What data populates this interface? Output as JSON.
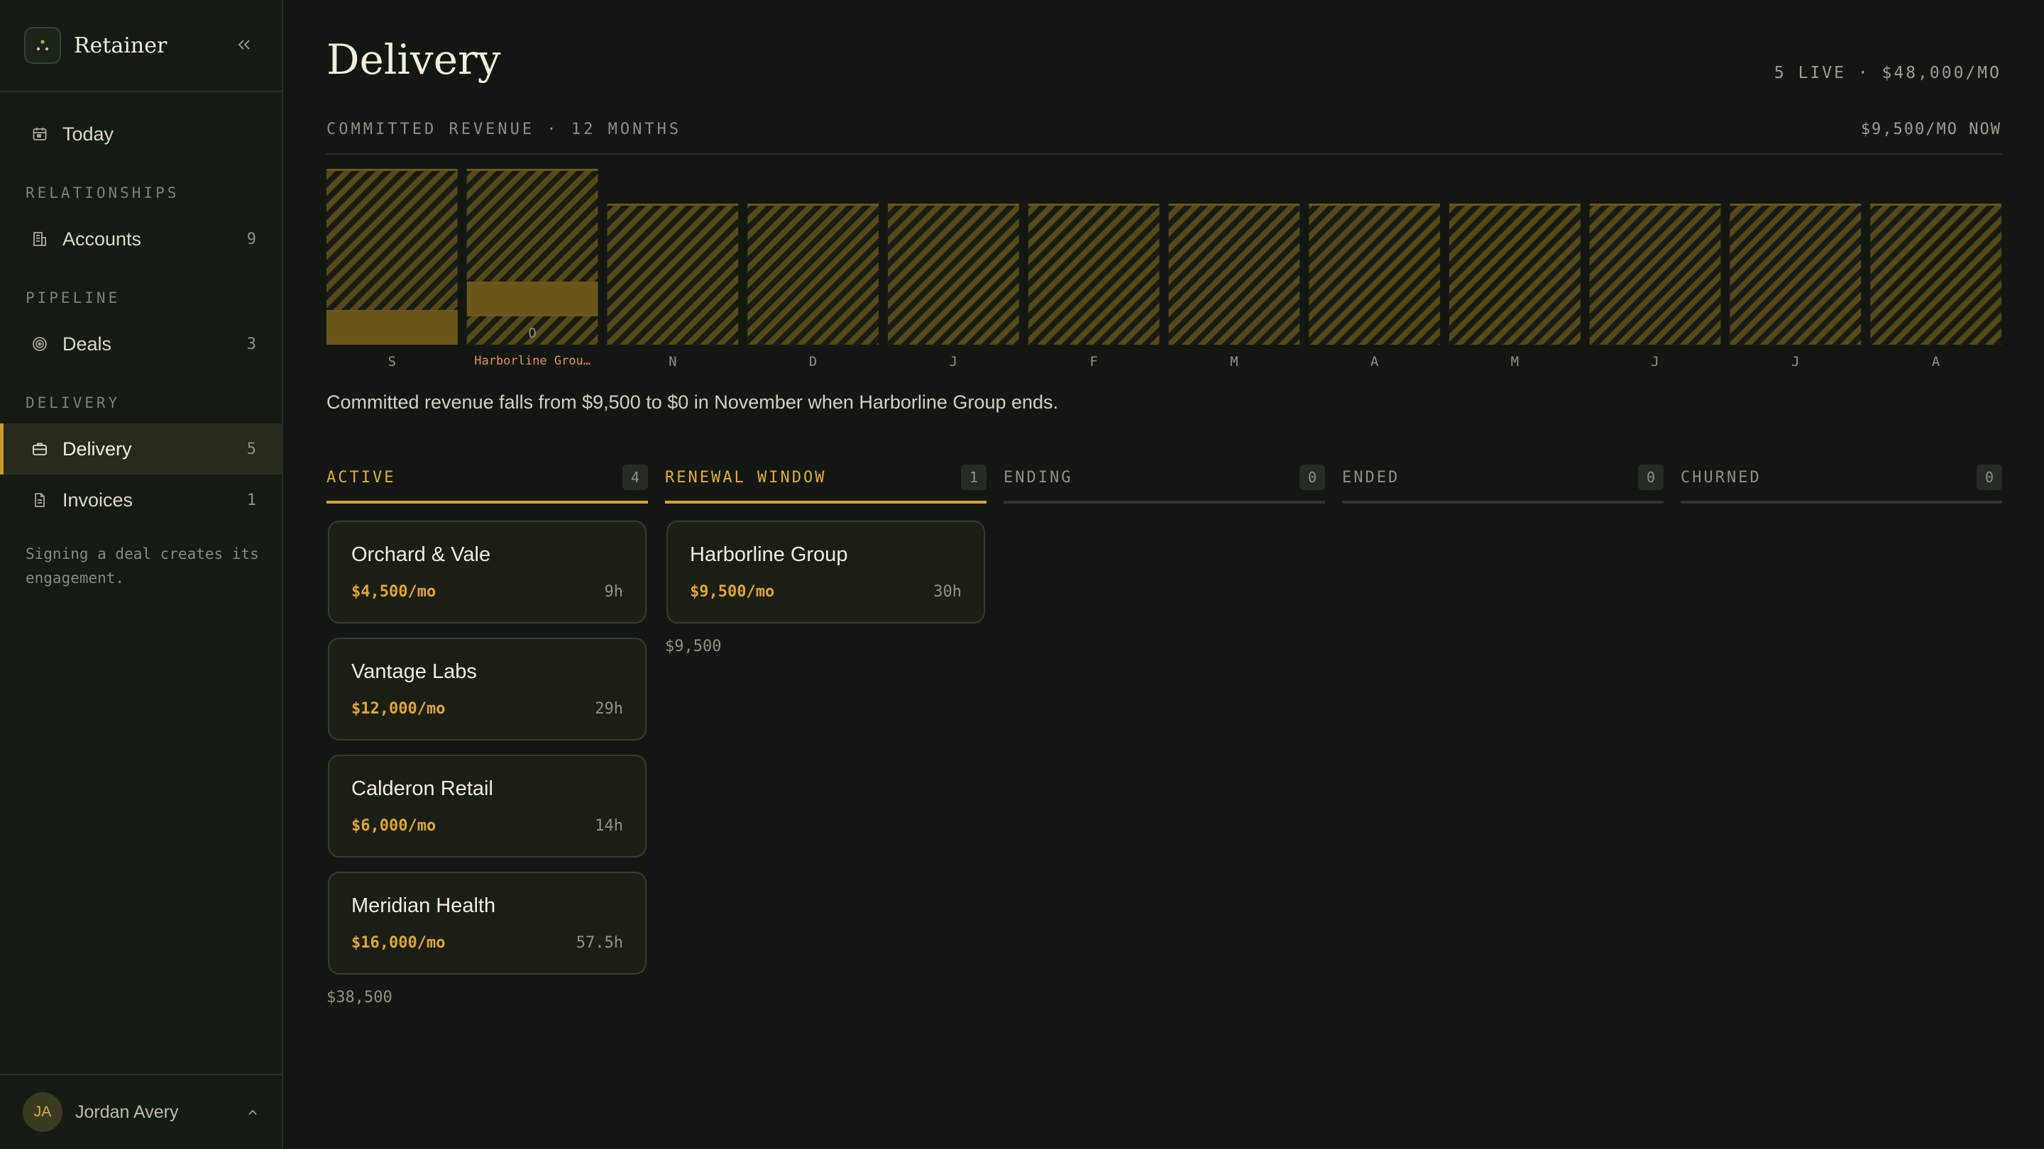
{
  "app": {
    "name": "Retainer"
  },
  "sidebar": {
    "today_label": "Today",
    "sections": {
      "relationships": "RELATIONSHIPS",
      "pipeline": "PIPELINE",
      "delivery": "DELIVERY"
    },
    "items": [
      {
        "label": "Accounts",
        "count": "9"
      },
      {
        "label": "Deals",
        "count": "3"
      },
      {
        "label": "Delivery",
        "count": "5"
      },
      {
        "label": "Invoices",
        "count": "1"
      }
    ],
    "note": "Signing a deal creates its engagement.",
    "user": {
      "initials": "JA",
      "name": "Jordan Avery"
    }
  },
  "page": {
    "title": "Delivery",
    "summary": "5 LIVE · $48,000/MO"
  },
  "chart_header": {
    "label": "COMMITTED REVENUE · 12 MONTHS",
    "now": "$9,500/MO NOW"
  },
  "chart_data": {
    "type": "bar",
    "categories": [
      "S",
      "O",
      "N",
      "D",
      "J",
      "F",
      "M",
      "A",
      "M",
      "J",
      "J",
      "A"
    ],
    "series": [
      {
        "values": [
          9500,
          9500,
          0,
          0,
          0,
          0,
          0,
          0,
          0,
          0,
          0,
          0
        ]
      }
    ],
    "committed_total_level": [
      48000,
      48000,
      38500,
      38500,
      38500,
      38500,
      38500,
      38500,
      38500,
      38500,
      38500,
      38500
    ],
    "annotations": [
      {
        "category_index": 1,
        "text": "Harborline Grou…"
      }
    ],
    "title": "COMMITTED REVENUE · 12 MONTHS",
    "ylim": [
      0,
      48000
    ],
    "colors": {
      "solid": "#6b561c",
      "hatch": "#5b4d1b",
      "background": "#121811",
      "annotation": "#e58d5c"
    }
  },
  "chart_note": "Committed revenue falls from $9,500 to $0 in November when Harborline Group ends.",
  "lanes": [
    {
      "title": "ACTIVE",
      "count": "4",
      "total": "$38,500",
      "cards": [
        {
          "name": "Orchard & Vale",
          "rate": "$4,500/mo",
          "hours": "9h"
        },
        {
          "name": "Vantage Labs",
          "rate": "$12,000/mo",
          "hours": "29h"
        },
        {
          "name": "Calderon Retail",
          "rate": "$6,000/mo",
          "hours": "14h"
        },
        {
          "name": "Meridian Health",
          "rate": "$16,000/mo",
          "hours": "57.5h"
        }
      ]
    },
    {
      "title": "RENEWAL WINDOW",
      "count": "1",
      "total": "$9,500",
      "cards": [
        {
          "name": "Harborline Group",
          "rate": "$9,500/mo",
          "hours": "30h"
        }
      ]
    },
    {
      "title": "ENDING",
      "count": "0"
    },
    {
      "title": "ENDED",
      "count": "0"
    },
    {
      "title": "CHURNED",
      "count": "0"
    }
  ],
  "colors": {
    "accent": "#d9a23a",
    "background": "#121811",
    "sidebar": "#141b13"
  }
}
